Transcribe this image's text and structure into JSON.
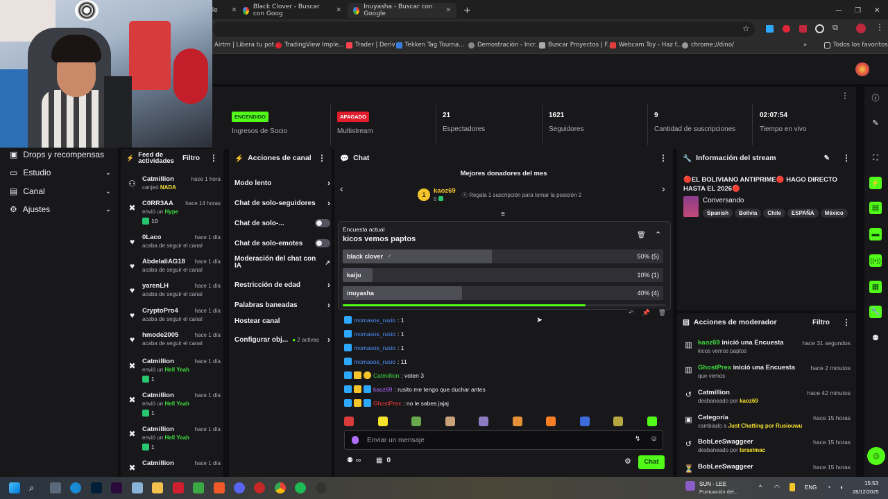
{
  "browser": {
    "tabs": [
      {
        "label": "gle"
      },
      {
        "label": "Black Clover - Buscar con Goog"
      },
      {
        "label": "Inuyasha - Buscar con Google"
      }
    ],
    "bookmarks": [
      {
        "label": "Airtm | Libera tu pot..."
      },
      {
        "label": "TradingView Imple..."
      },
      {
        "label": "Trader | Deriv"
      },
      {
        "label": "Tekken Tag Tourna..."
      },
      {
        "label": "Demostración - Incr..."
      },
      {
        "label": "Buscar Proyectos | F..."
      },
      {
        "label": "Webcam Toy - Haz f..."
      },
      {
        "label": "chrome://dino/"
      },
      {
        "label": "Todos los favoritos"
      }
    ]
  },
  "stats": {
    "socio_badge": "ENCENDIDO",
    "socio_label": "Ingresos de Socio",
    "multi_badge": "APAGADO",
    "multi_label": "Multistream",
    "viewers": "21",
    "viewers_label": "Espectadores",
    "followers": "1621",
    "followers_label": "Seguidores",
    "subs": "9",
    "subs_label": "Cantidad de suscripciones",
    "live_time": "02:07:54",
    "live_label": "Tiempo en vivo"
  },
  "sidebar": {
    "items": [
      {
        "label": "Drops y recompensas"
      },
      {
        "label": "Estudio"
      },
      {
        "label": "Canal"
      },
      {
        "label": "Ajustes"
      }
    ]
  },
  "feed": {
    "title": "Feed de actividades",
    "filter": "Filtro",
    "items": [
      {
        "name": "Catmillion",
        "time": "hace 1 hora",
        "sub_pre": "canjeó",
        "sub_hl": "NADA",
        "amount": ""
      },
      {
        "name": "C0RR3AA",
        "time": "hace 14 horas",
        "sub_pre": "envió un",
        "sub_hl": "Hype",
        "amount": "10"
      },
      {
        "name": "0Laco",
        "time": "hace 1 día",
        "sub_pre": "acaba de seguir el canal",
        "sub_hl": "",
        "amount": ""
      },
      {
        "name": "AbdelaliAG18",
        "time": "hace 1 día",
        "sub_pre": "acaba de seguir el canal",
        "sub_hl": "",
        "amount": ""
      },
      {
        "name": "yarenLH",
        "time": "hace 1 día",
        "sub_pre": "acaba de seguir el canal",
        "sub_hl": "",
        "amount": ""
      },
      {
        "name": "CryptoPro4",
        "time": "hace 1 día",
        "sub_pre": "acaba de seguir el canal",
        "sub_hl": "",
        "amount": ""
      },
      {
        "name": "hmode2005",
        "time": "hace 1 día",
        "sub_pre": "acaba de seguir el canal",
        "sub_hl": "",
        "amount": ""
      },
      {
        "name": "Catmillion",
        "time": "hace 1 día",
        "sub_pre": "envió un",
        "sub_hl": "Hell Yeah",
        "amount": "1"
      },
      {
        "name": "Catmillion",
        "time": "hace 1 día",
        "sub_pre": "envió un",
        "sub_hl": "Hell Yeah",
        "amount": "1"
      },
      {
        "name": "Catmillion",
        "time": "hace 1 día",
        "sub_pre": "envió un",
        "sub_hl": "Hell Yeah",
        "amount": "1"
      },
      {
        "name": "Catmillion",
        "time": "hace 1 día",
        "sub_pre": "",
        "sub_hl": "",
        "amount": ""
      }
    ]
  },
  "actions": {
    "title": "Acciones de canal",
    "items": [
      {
        "label": "Modo lento"
      },
      {
        "label": "Chat de solo-seguidores"
      },
      {
        "label": "Chat de solo-..."
      },
      {
        "label": "Chat de solo-emotes"
      },
      {
        "label": "Moderación del chat con IA"
      },
      {
        "label": "Restricción de edad"
      },
      {
        "label": "Palabras baneadas"
      },
      {
        "label": "Hostear canal"
      },
      {
        "label": "Configurar obj..."
      }
    ],
    "active_count": "2 activas"
  },
  "chat": {
    "title": "Chat",
    "donors_title": "Mejores donadores del mes",
    "donor_name": "kaoz69",
    "donor_amount": "5",
    "donor_rank": "1",
    "gift_text": "Regala 1 suscripción para tomar la posición 2",
    "poll": {
      "label": "Encuesta actual",
      "question": "kicos vemos paptos",
      "options": [
        {
          "label": "black clover",
          "pct": "50% (5)",
          "value": 0.5
        },
        {
          "label": "kaiju",
          "pct": "10% (1)",
          "value": 0.1
        },
        {
          "label": "inuyasha",
          "pct": "40% (4)",
          "value": 0.4
        }
      ],
      "time_left": 0.75
    },
    "messages": [
      {
        "user": "momasos_rusio",
        "text": ": 1",
        "color": "#4f8ff7"
      },
      {
        "user": "momasos_rusio",
        "text": ": 1",
        "color": "#4f8ff7"
      },
      {
        "user": "momasos_rusio",
        "text": ": 1",
        "color": "#4f8ff7"
      },
      {
        "user": "momasos_rusio",
        "text": ": 11",
        "color": "#4f8ff7"
      },
      {
        "user": "Catmillion",
        "text": ": voten 3",
        "color": "#3edb3e"
      },
      {
        "user": "kaoz69",
        "text": ": rusito me tengo que duchar antes",
        "color": "#b06cff"
      },
      {
        "user": "GhostPrex",
        "text": ": no le sabes jajaj",
        "color": "#ff3d3d"
      }
    ],
    "input_placeholder": "Enviar un mensaje",
    "points": "0",
    "send": "Chat"
  },
  "stream_info": {
    "title": "Información del stream",
    "stream_title": "🔴EL BOLIVIANO ANTIPRIME🔴 HAGO DIRECTO HASTA EL 2026🔴",
    "category": "Conversando",
    "tags": [
      "Spanish",
      "Bolivia",
      "Chile",
      "ESPAÑA",
      "México"
    ]
  },
  "mod_actions": {
    "title": "Acciones de moderador",
    "filter": "Filtro",
    "items": [
      {
        "actor": "kaoz69",
        "action": " inició una Encuesta",
        "time": "hace 31 segundos",
        "sub": "kicos vemos paptos",
        "sub_hl": ""
      },
      {
        "actor": "GhostPrex",
        "action": " inició una Encuesta",
        "time": "hace 2 minutos",
        "sub": "que vemos",
        "sub_hl": ""
      },
      {
        "actor": "",
        "action": "Catmillion",
        "time": "hace 42 minutos",
        "sub": "desbaneado por ",
        "sub_hl": "kaoz69"
      },
      {
        "actor": "",
        "action": "Categoría",
        "time": "hace 15 horas",
        "sub": "cambiado a ",
        "sub_hl": "Just Chatting por Rusiouwu"
      },
      {
        "actor": "",
        "action": "BobLeeSwaggeer",
        "time": "hace 15 horas",
        "sub": "desbaneado por ",
        "sub_hl": "Israelmac"
      },
      {
        "actor": "",
        "action": "BobLeeSwaggeer",
        "time": "hace 15 horas",
        "sub": "",
        "sub_hl": ""
      }
    ]
  },
  "taskbar": {
    "now_playing": "SUN - LEE",
    "now_playing_sub": "Puntuación del...",
    "lang": "ENG",
    "time": "15:53",
    "date": "28/12/2025"
  },
  "colors": {
    "accent_green": "#53fc18",
    "brand_bg": "#18181b",
    "off_red": "#e11d2e"
  }
}
